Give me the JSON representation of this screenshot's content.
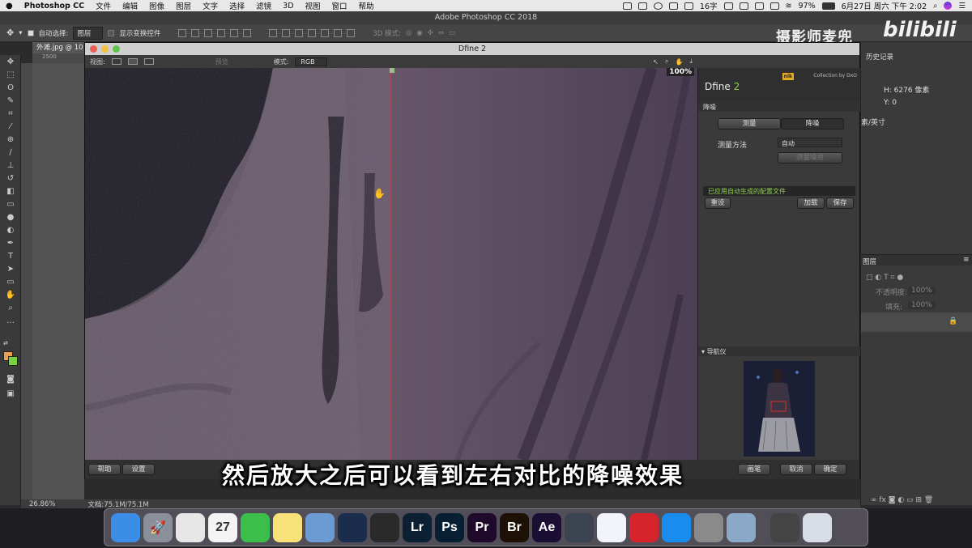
{
  "menubar": {
    "apple": "",
    "app": "Photoshop CC",
    "items": [
      "文件",
      "编辑",
      "图像",
      "图层",
      "文字",
      "选择",
      "滤镜",
      "3D",
      "视图",
      "窗口",
      "帮助"
    ],
    "ime": "16字",
    "battery": "97%",
    "datetime": "6月27日 周六 下午 2:02"
  },
  "ps": {
    "title": "Adobe Photoshop CC 2018",
    "opt_auto_select": "自动选择:",
    "opt_layer": "图层",
    "opt_show_transform": "显示变换控件",
    "opt_3d_mode": "3D 模式:",
    "doc_tab": "外滩.jpg @ 10",
    "ruler_mark": "2500",
    "zoom": "26.86%",
    "doc_size": "文档:75.1M/75.1M",
    "history_tab": "历史记录",
    "info_h": "H: 6276 像素",
    "info_y": "Y: 0",
    "info_unit": "素/英寸",
    "layers_tab": "图层",
    "opacity_label": "不透明度:",
    "opacity_value": "100%",
    "fill_label": "填充:",
    "fill_value": "100%",
    "fx": "fx"
  },
  "watermark": {
    "channel": "摄影师麦兜",
    "site": "bilibili"
  },
  "dfine": {
    "title": "Dfine 2",
    "view_label": "视图:",
    "preview_label": "预览",
    "mode_label": "模式:",
    "mode_value": "RGB",
    "zoom": "100%",
    "brand_small": "Collection by DxO",
    "brand_nik": "nik",
    "product": "Dfine",
    "product_version": "2",
    "section_noise": "降噪",
    "tab_measure": "测量",
    "tab_reduce": "降噪",
    "method_label": "测量方法",
    "method_value": "自动",
    "measure_noise_btn": "测量噪点",
    "status_msg": "已应用自动生成的配置文件",
    "reset_btn": "重设",
    "load_btn": "加载",
    "save_btn": "保存",
    "navigator": "导航仪",
    "help_btn": "帮助",
    "settings_btn": "设置",
    "brush_btn": "画笔",
    "cancel_btn": "取消",
    "ok_btn": "确定"
  },
  "subtitle": "然后放大之后可以看到左右对比的降噪效果",
  "dock": [
    {
      "name": "finder",
      "label": "",
      "color": "#3a8ee6"
    },
    {
      "name": "launchpad",
      "label": "🚀",
      "color": "#8a8f99"
    },
    {
      "name": "chrome",
      "label": "",
      "color": "#e7e7e7"
    },
    {
      "name": "calendar",
      "label": "27",
      "color": "#f4f4f4"
    },
    {
      "name": "wechat",
      "label": "",
      "color": "#3cbf4a"
    },
    {
      "name": "notes",
      "label": "",
      "color": "#f7e27a"
    },
    {
      "name": "preview",
      "label": "",
      "color": "#6c9bd4"
    },
    {
      "name": "cinema4d",
      "label": "",
      "color": "#1b2d4d"
    },
    {
      "name": "davinci",
      "label": "",
      "color": "#2a2a2a"
    },
    {
      "name": "lightroom",
      "label": "Lr",
      "color": "#0b2133"
    },
    {
      "name": "photoshop",
      "label": "Ps",
      "color": "#061f33"
    },
    {
      "name": "premiere",
      "label": "Pr",
      "color": "#1f0a2b"
    },
    {
      "name": "bridge",
      "label": "Br",
      "color": "#1d1004"
    },
    {
      "name": "aftereffects",
      "label": "Ae",
      "color": "#1a0f33"
    },
    {
      "name": "lumix",
      "label": "",
      "color": "#3b4250"
    },
    {
      "name": "baidu-netdisk",
      "label": "",
      "color": "#f1f4fa"
    },
    {
      "name": "netease-music",
      "label": "",
      "color": "#d6232c"
    },
    {
      "name": "app-store",
      "label": "",
      "color": "#1a8cf0"
    },
    {
      "name": "system-preferences",
      "label": "",
      "color": "#8a8a8a"
    },
    {
      "name": "image-capture",
      "label": "",
      "color": "#8ba8c6"
    },
    {
      "name": "screen-app",
      "label": "",
      "color": "#444"
    },
    {
      "name": "trash",
      "label": "",
      "color": "#d7dde4"
    }
  ],
  "colors": {
    "accent_green": "#8fd14f",
    "split_line": "#d0333c",
    "preview_tint": "#5e4e63"
  }
}
